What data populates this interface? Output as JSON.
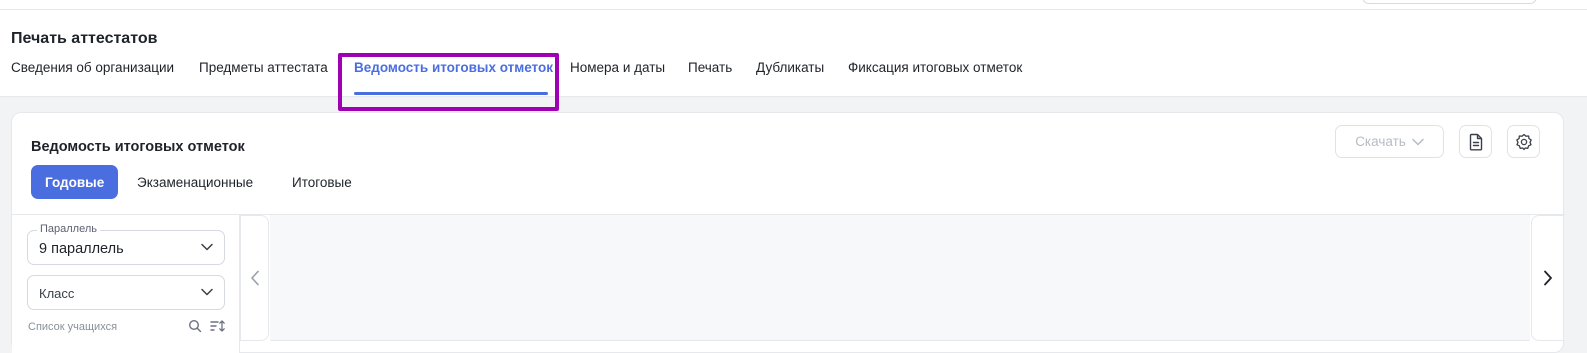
{
  "header": {
    "title": "Печать аттестатов",
    "tabs": [
      {
        "label": "Сведения об организации"
      },
      {
        "label": "Предметы аттестата"
      },
      {
        "label": "Ведомость итоговых отметок",
        "active": true
      },
      {
        "label": "Номера и даты"
      },
      {
        "label": "Печать"
      },
      {
        "label": "Дубликаты"
      },
      {
        "label": "Фиксация итоговых отметок"
      }
    ]
  },
  "card": {
    "title": "Ведомость итоговых отметок",
    "download_label": "Скачать",
    "download_icon": "chevron-down-icon",
    "doc_icon": "document-icon",
    "settings_icon": "gear-icon",
    "subtabs": [
      {
        "label": "Годовые",
        "active": true
      },
      {
        "label": "Экзаменационные"
      },
      {
        "label": "Итоговые"
      }
    ]
  },
  "filters": {
    "parallel_label": "Параллель",
    "parallel_value": "9 параллель",
    "class_placeholder": "Класс",
    "students_label": "Список учащихся",
    "search_icon": "search-icon",
    "sort_icon": "sort-icon"
  },
  "nav": {
    "prev_icon": "chevron-left-icon",
    "next_icon": "chevron-right-icon"
  },
  "colors": {
    "accent": "#4a6ee0",
    "highlight": "#a000b4"
  }
}
